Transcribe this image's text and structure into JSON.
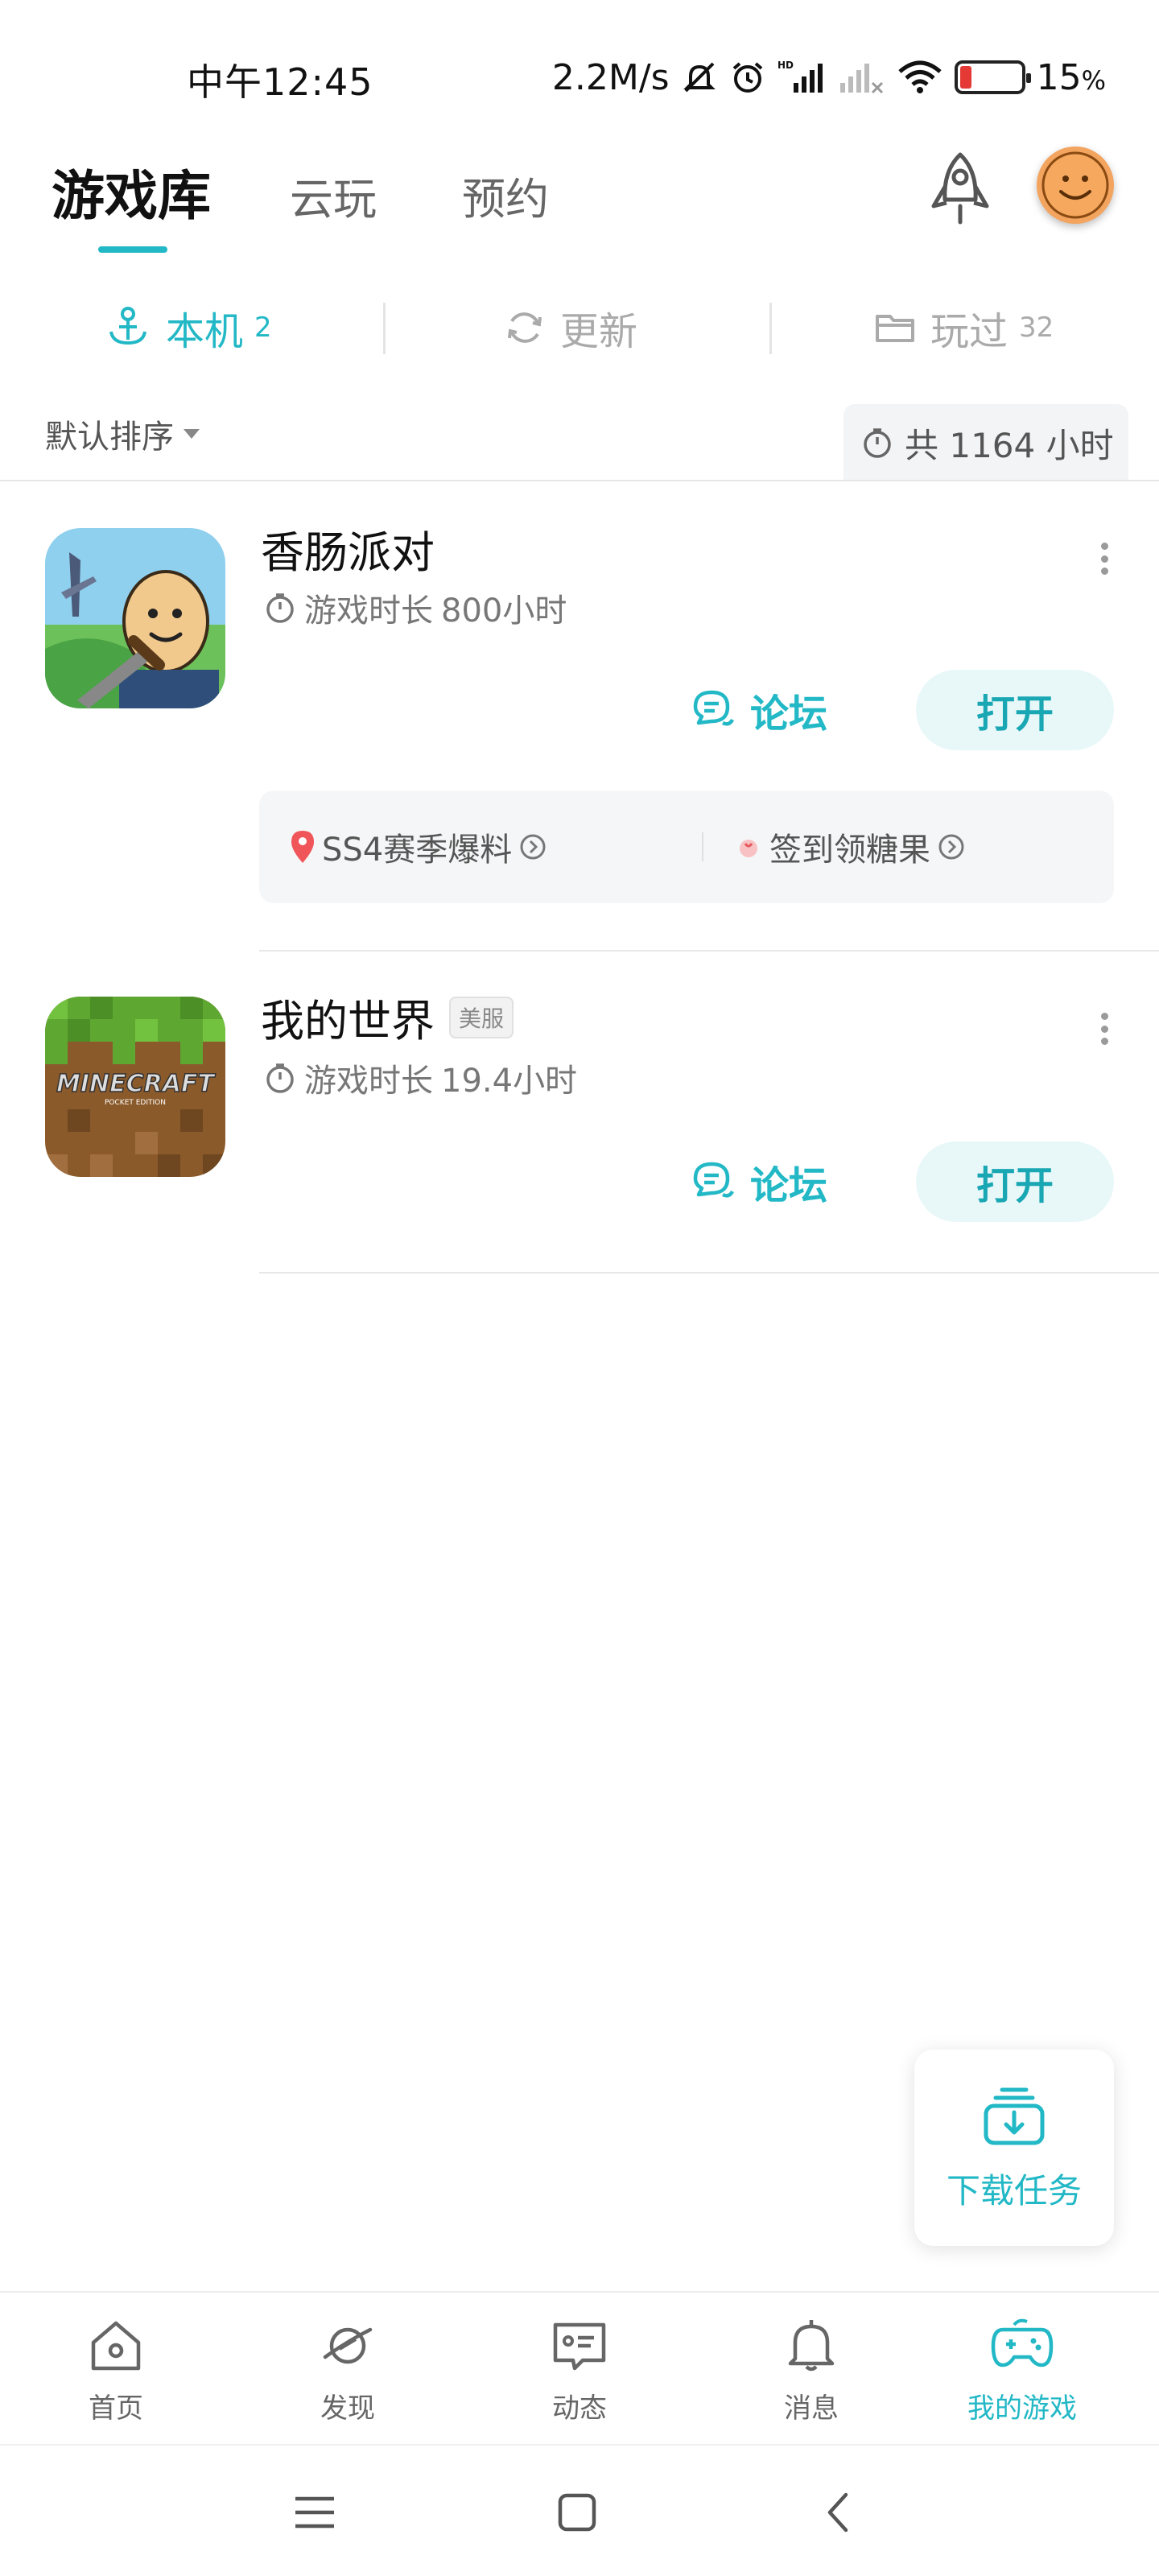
{
  "status_bar": {
    "time": "中午12:45",
    "net_speed": "2.2M/s",
    "battery_percent": "15",
    "battery_unit": "%"
  },
  "header": {
    "tabs": [
      {
        "label": "游戏库",
        "active": true
      },
      {
        "label": "云玩",
        "active": false
      },
      {
        "label": "预约",
        "active": false
      }
    ],
    "rocket_icon": "rocket-icon",
    "avatar_icon": "smiley-avatar"
  },
  "sub_tabs": [
    {
      "label": "本机",
      "count": "2",
      "icon": "anchor-icon",
      "active": true
    },
    {
      "label": "更新",
      "count": "",
      "icon": "refresh-icon",
      "active": false
    },
    {
      "label": "玩过",
      "count": "32",
      "icon": "folder-icon",
      "active": false
    }
  ],
  "sort": {
    "label": "默认排序"
  },
  "total_hours": {
    "label": "共 1164 小时"
  },
  "games": [
    {
      "title": "香肠派对",
      "badge": "",
      "play_time_label": "游戏时长",
      "play_time_value": "800小时",
      "forum_label": "论坛",
      "open_label": "打开",
      "promos": [
        {
          "label": "SS4赛季爆料",
          "icon": "pin-icon"
        },
        {
          "label": "签到领糖果",
          "icon": "candy-icon"
        }
      ]
    },
    {
      "title": "我的世界",
      "badge": "美服",
      "play_time_label": "游戏时长",
      "play_time_value": "19.4小时",
      "forum_label": "论坛",
      "open_label": "打开",
      "icon_text": "MINECRAFT",
      "icon_subtext": "POCKET EDITION"
    }
  ],
  "download_task": {
    "label": "下载任务"
  },
  "bottom_nav": [
    {
      "label": "首页",
      "icon": "home-icon",
      "active": false
    },
    {
      "label": "发现",
      "icon": "planet-icon",
      "active": false
    },
    {
      "label": "动态",
      "icon": "message-card-icon",
      "active": false
    },
    {
      "label": "消息",
      "icon": "bell-icon",
      "active": false
    },
    {
      "label": "我的游戏",
      "icon": "gamepad-icon",
      "active": true
    }
  ],
  "colors": {
    "accent": "#22b8c6",
    "open_bg": "#e8f7f8",
    "text": "#111111",
    "muted": "#777777"
  }
}
